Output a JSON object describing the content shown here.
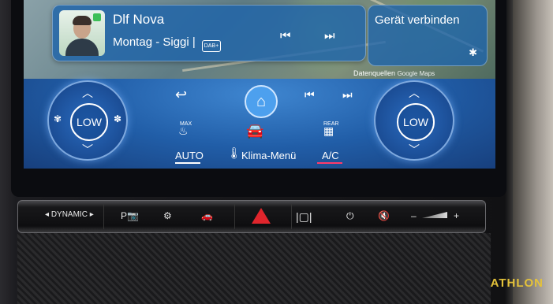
{
  "media": {
    "station": "Dlf Nova",
    "subtitle": "Montag - Siggi |",
    "dab_label": "DAB+",
    "prev_icon": "⏮",
    "next_icon": "⏭"
  },
  "connect": {
    "label": "Gerät verbinden",
    "bluetooth_icon": "bluetooth-icon"
  },
  "map": {
    "attribution": "Datenquellen",
    "google": "Google Maps"
  },
  "climate": {
    "left_fan": "LOW",
    "right_fan": "LOW",
    "max_label": "MAX",
    "rear_label": "REAR",
    "auto_label": "AUTO",
    "menu_label": "Klima-Menü",
    "ac_label": "A/C"
  },
  "hardware": {
    "dynamic_label": "DYNAMIC",
    "volume_minus": "–",
    "volume_plus": "+"
  },
  "branding": {
    "logo_text": "ATHLON"
  },
  "colors": {
    "accent": "#4da0ee",
    "ac_underline": "#ff3b6b",
    "hazard": "#e0252c"
  }
}
